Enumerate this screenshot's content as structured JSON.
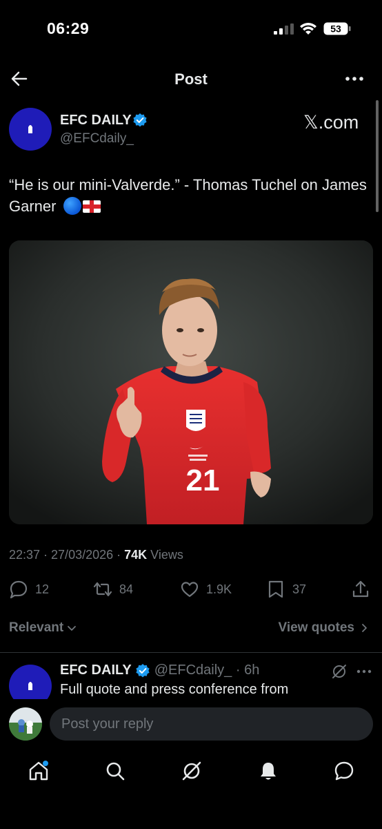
{
  "status_bar": {
    "time": "06:29",
    "battery": "53"
  },
  "header": {
    "title": "Post",
    "back_icon": "back-arrow-icon",
    "more_icon": "more-icon"
  },
  "post": {
    "author_name": "EFC DAILY",
    "author_handle": "@EFCdaily_",
    "source_badge": "𝕏.com",
    "text": "“He is our mini-Valverde.” - Thomas Tuchel on James Garner",
    "timestamp": "22:37 · 27/03/2026 · ",
    "views_count": "74K",
    "views_label": " Views",
    "actions": {
      "replies": "12",
      "reposts": "84",
      "likes": "1.9K",
      "bookmarks": "37"
    }
  },
  "filters": {
    "sort_label": "Relevant",
    "view_quotes": "View quotes"
  },
  "reply": {
    "author_name": "EFC DAILY",
    "author_handle": "@EFCdaily_ · 6h",
    "text": "Full quote and press conference from"
  },
  "composer": {
    "placeholder": "Post your reply"
  },
  "bottom_nav": {
    "items": [
      "home-icon",
      "search-icon",
      "grok-icon",
      "notifications-icon",
      "messages-icon"
    ]
  },
  "colors": {
    "background": "#000000",
    "text": "#e7e9ea",
    "muted": "#71767b",
    "verified": "#1d9bf0",
    "avatar": "#1f1cb8"
  }
}
